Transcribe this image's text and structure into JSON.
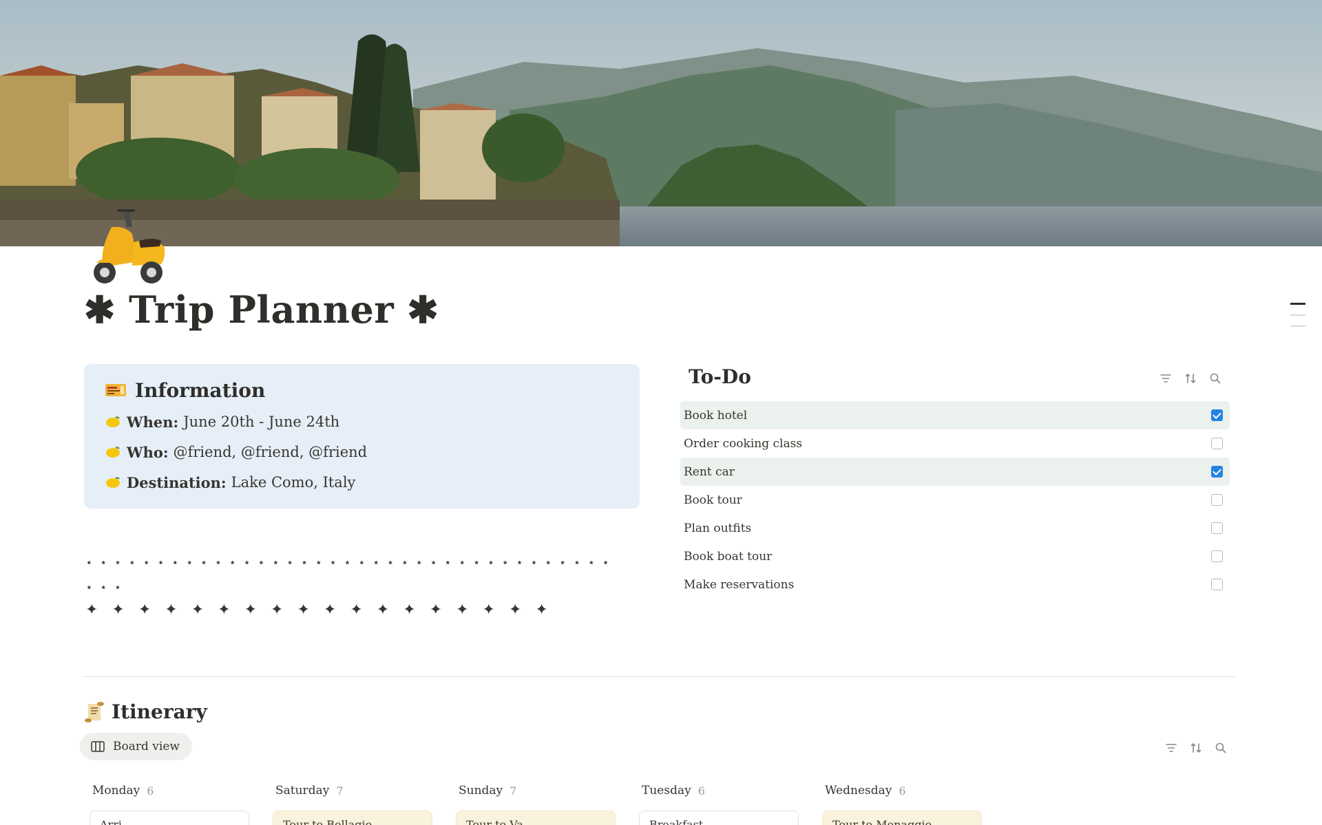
{
  "page": {
    "title": "✱ Trip Planner ✱",
    "icon": "scooter-icon"
  },
  "information": {
    "heading": "Information",
    "heading_icon": "ticket-icon",
    "rows": [
      {
        "label": "When:",
        "value": "June 20th - June 24th"
      },
      {
        "label": "Who:",
        "value": "@friend, @friend, @friend"
      },
      {
        "label": "Destination:",
        "value": "Lake Como, Italy"
      }
    ],
    "row_icon": "lemon-icon",
    "bg_color": "#e6eff8"
  },
  "decor": {
    "small_stars": "⋆⋆⋆⋆⋆⋆⋆⋆⋆⋆⋆⋆⋆⋆⋆⋆⋆⋆⋆⋆⋆⋆⋆⋆⋆⋆⋆⋆⋆⋆⋆⋆⋆⋆⋆⋆⋆⋆⋆⋆",
    "big_stars": "✦✦✦✦✦✦✦✦✦✦✦✦✦✦✦✦✦✦"
  },
  "todo": {
    "title": "To-Do",
    "items": [
      {
        "label": "Book hotel",
        "done": true
      },
      {
        "label": "Order cooking class",
        "done": false
      },
      {
        "label": "Rent car",
        "done": true
      },
      {
        "label": "Book tour",
        "done": false
      },
      {
        "label": "Plan outfits",
        "done": false
      },
      {
        "label": "Book boat tour",
        "done": false
      },
      {
        "label": "Make reservations",
        "done": false
      }
    ],
    "checked_color": "#2383e2",
    "done_row_color": "#ebf1ed"
  },
  "itinerary": {
    "title": "Itinerary",
    "title_icon": "scroll-icon",
    "view_label": "Board view",
    "columns": [
      {
        "name": "Monday",
        "count": "6",
        "card": "Arri",
        "card_style": "white"
      },
      {
        "name": "Saturday",
        "count": "7",
        "card": "Tour to Bellagio",
        "card_style": "yellow"
      },
      {
        "name": "Sunday",
        "count": "7",
        "card": "Tour to Va",
        "card_style": "yellow"
      },
      {
        "name": "Tuesday",
        "count": "6",
        "card": "Breakfast",
        "card_style": "white"
      },
      {
        "name": "Wednesday",
        "count": "6",
        "card": "Tour to Menaggio",
        "card_style": "yellow"
      }
    ]
  },
  "toolbar_icons": [
    "filter-icon",
    "sort-icon",
    "search-icon"
  ]
}
